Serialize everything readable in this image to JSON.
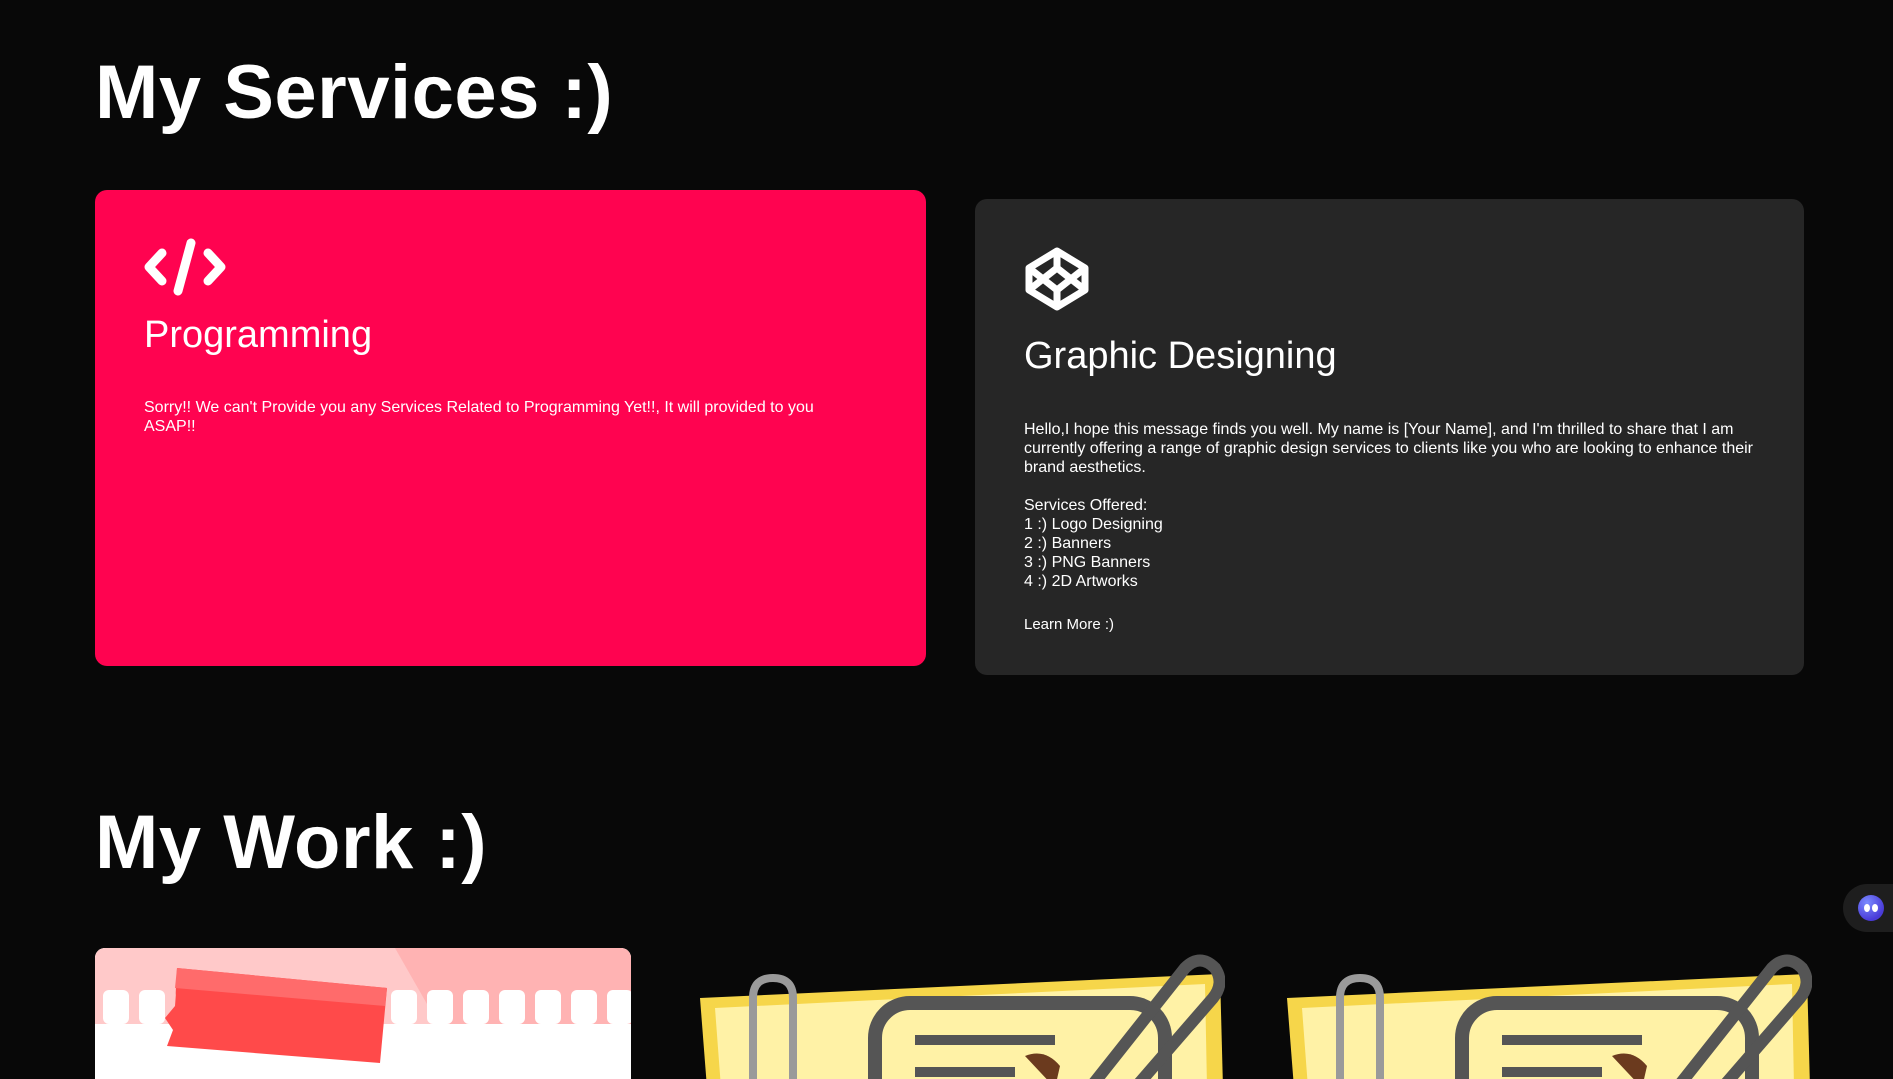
{
  "services": {
    "title": "My Services :)",
    "cards": [
      {
        "icon": "code-icon",
        "title": "Programming",
        "description": "Sorry!! We can't Provide you any Services Related to Programming Yet!!, It will provided to you ASAP!!",
        "background": "#ff0350"
      },
      {
        "icon": "codepen-icon",
        "title": "Graphic Designing",
        "description": "Hello,I hope this message finds you well. My name is [Your Name], and I'm thrilled to share that I am currently offering a range of graphic design services to clients like you who are looking to enhance their brand aesthetics.",
        "services_heading": "Services Offered:",
        "services_list": [
          "1 :) Logo Designing",
          "2 :) Banners",
          "3 :) PNG Banners",
          "4 :) 2D Artworks"
        ],
        "learn_more": "Learn More :)",
        "background": "#262626"
      }
    ]
  },
  "work": {
    "title": "My Work :)",
    "items": [
      {
        "image": "torn-tape-banner-image"
      },
      {
        "image": "sticky-note-paperclip-image"
      },
      {
        "image": "sticky-note-paperclip-image"
      }
    ]
  },
  "assistant": {
    "icon": "assistant-bot-icon"
  },
  "colors": {
    "background": "#080808",
    "accent": "#ff0350",
    "card_dark": "#262626"
  }
}
